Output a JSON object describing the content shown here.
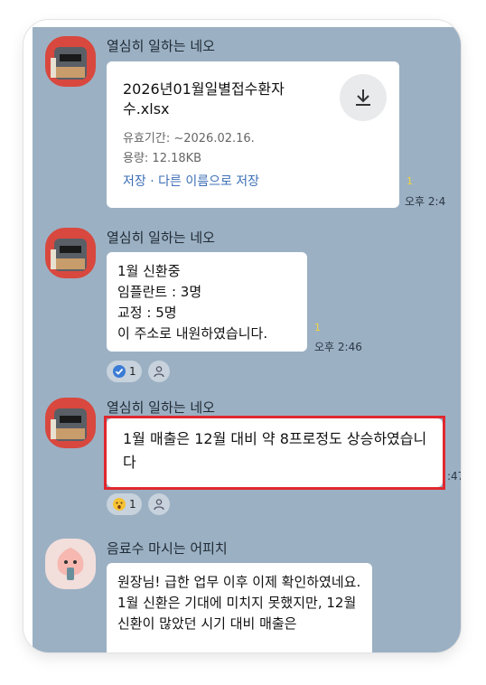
{
  "messages": [
    {
      "sender": "열심히 일하는 네오",
      "file": {
        "name": "2026년01월일별접수환자수.xlsx",
        "expiry": "유효기간: ~2026.02.16.",
        "size": "용량: 12.18KB",
        "save": "저장",
        "separator": "·",
        "save_as": "다른 이름으로 저장"
      },
      "unread": "1",
      "time": "오후 2:4"
    },
    {
      "sender": "열심히 일하는 네오",
      "text": "1월 신환중\n임플란트 : 3명\n교정 : 5명\n이 주소로 내원하였습니다.",
      "unread": "1",
      "time": "오후 2:46",
      "reaction": {
        "emoji": "check-icon",
        "count": "1"
      }
    },
    {
      "sender": "열심히 일하는 네오",
      "text": "1월 매출은 12월 대비 약 8프로정도 상승하였습니다",
      "time": ":47",
      "reaction": {
        "emoji": "surprised-face-icon",
        "count": "1"
      }
    },
    {
      "sender": "음료수 마시는 어피치",
      "text": "원장님! 급한 업무 이후 이제 확인하였네요.\n1월 신환은 기대에 미치지 못했지만, 12월 신환이 많았던 시기 대비 매출은"
    }
  ],
  "colors": {
    "chat_background": "#9bb0c3",
    "highlight_border": "#e0282e",
    "link": "#3d6fb5",
    "unread": "#f2d33a"
  }
}
